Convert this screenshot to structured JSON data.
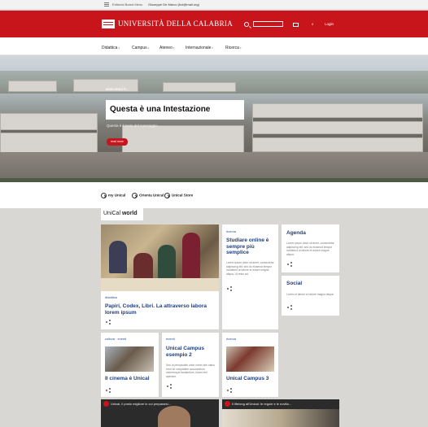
{
  "topbar": {
    "menu_label": "Editorial Board Menu",
    "user": "Giuseppe De Marco (fcd@mail.org)"
  },
  "header": {
    "logo_text": "UNIVERSITÀ DELLA CALABRIA",
    "mail_count": "0",
    "login_label": "Login"
  },
  "nav": {
    "items": [
      {
        "label": "Didattica"
      },
      {
        "label": "Campus"
      },
      {
        "label": "Ateneo"
      },
      {
        "label": "Internazionale"
      },
      {
        "label": "Ricerca"
      }
    ]
  },
  "hero": {
    "kicker": "BENVENUTI",
    "headline": "Questa è una Intestazione",
    "subline": "Questa è il testo del messaggio",
    "button_label": "read more"
  },
  "quicklinks": [
    {
      "label": "my Unical"
    },
    {
      "label": "Orienta Unical"
    },
    {
      "label": "Unical Store"
    }
  ],
  "section": {
    "title_light": "UniCal",
    "title_bold": "world"
  },
  "cards": {
    "didattica": {
      "tag": "didattica",
      "title": "Papiri, Codex, Libri. La attraverso labora lorem ipsum"
    },
    "ricerca1": {
      "tag": "ricerca",
      "title": "Studiare online è sempre più semplice",
      "body": "Lorem ipsum dolor sit amet, consectetur adipiscing elit, sed do eiusmod tempor incididunt ut labore et dolore magna aliqua. Ut enim ad."
    },
    "agenda": {
      "title": "Agenda",
      "body": "Lorem ipsum dolor sit amet, consectetur adipiscing elit, sed do eiusmod tempor incididunt ut labore et dolore magna aliqua."
    },
    "social": {
      "title": "Social",
      "body": "Lorem ut labore et dolore magna aliqua."
    },
    "cultura": {
      "tag": "cultura · eventi",
      "title": "Il cinema è Unical"
    },
    "eventi": {
      "tag": "eventi",
      "title": "Unical Campus esempio 2",
      "body": "Sed ut perspiciatis unde omnis iste natus error sit voluptatem accusantium doloremque laudantium, totam rem aperiam."
    },
    "ricerca2": {
      "tag": "ricerca",
      "title": "Unical Campus 3"
    }
  },
  "videos": [
    {
      "title": "Unical, il posto migliore in cui prepararsi..."
    },
    {
      "title": "Il lifelong all'Unical: le regole e le novità..."
    }
  ],
  "colors": {
    "brand_red": "#c8141b",
    "link_blue": "#1f3d7a",
    "page_bg": "#d9d7d3"
  }
}
